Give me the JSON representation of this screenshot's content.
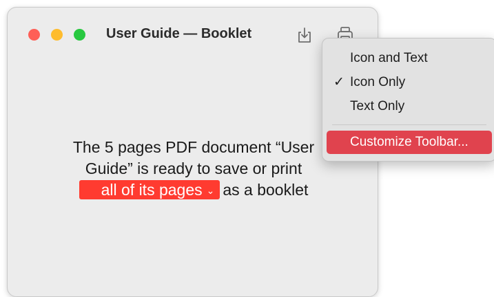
{
  "window": {
    "title": "User Guide — Booklet",
    "message_line1": "The 5 pages PDF document “User",
    "message_line2": "Guide” is ready to save or print",
    "pages_popup_label": "all of its pages",
    "message_line3_suffix": "as a booklet"
  },
  "context_menu": {
    "items": [
      {
        "label": "Icon and Text",
        "checked": false
      },
      {
        "label": "Icon Only",
        "checked": true,
        "check_mark": "✓"
      },
      {
        "label": "Text Only",
        "checked": false
      },
      {
        "label": "Customize Toolbar...",
        "highlighted": true
      }
    ]
  },
  "colors": {
    "close": "#fe5f57",
    "minimize": "#febc2e",
    "maximize": "#28c840",
    "popup_accent": "#ff3b30",
    "menu_highlight": "#e0434e"
  }
}
